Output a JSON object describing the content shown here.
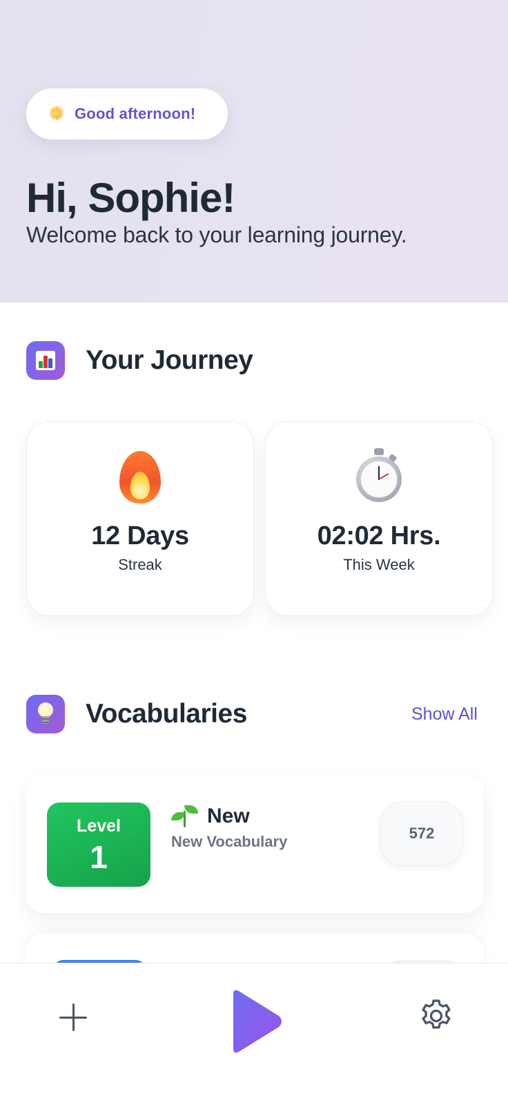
{
  "header": {
    "greeting": "Good afternoon!",
    "greeting_icon": "sun-icon",
    "hello": "Hi, Sophie!",
    "welcome": "Welcome back to your learning journey."
  },
  "journey": {
    "title": "Your Journey",
    "icon": "bar-chart-icon",
    "stats": [
      {
        "icon": "fire-icon",
        "value": "12 Days",
        "label": "Streak"
      },
      {
        "icon": "stopwatch-icon",
        "value": "02:02 Hrs.",
        "label": "This Week"
      }
    ]
  },
  "vocab": {
    "title": "Vocabularies",
    "icon": "lightbulb-icon",
    "show_all": "Show All",
    "levels": [
      {
        "level_label": "Level",
        "level_number": "1",
        "badge_color": "#22c55e",
        "icon": "sprout-icon",
        "title": "New",
        "subtitle": "New Vocabulary",
        "count": "572"
      }
    ]
  },
  "bottom_bar": {
    "left_icon": "plus-icon",
    "center_icon": "play-icon",
    "right_icon": "gear-icon"
  },
  "colors": {
    "accent": "#5b52d6",
    "play_gradient_start": "#6f6cf3",
    "play_gradient_end": "#9a55e6",
    "level_green": "#22c55e"
  }
}
